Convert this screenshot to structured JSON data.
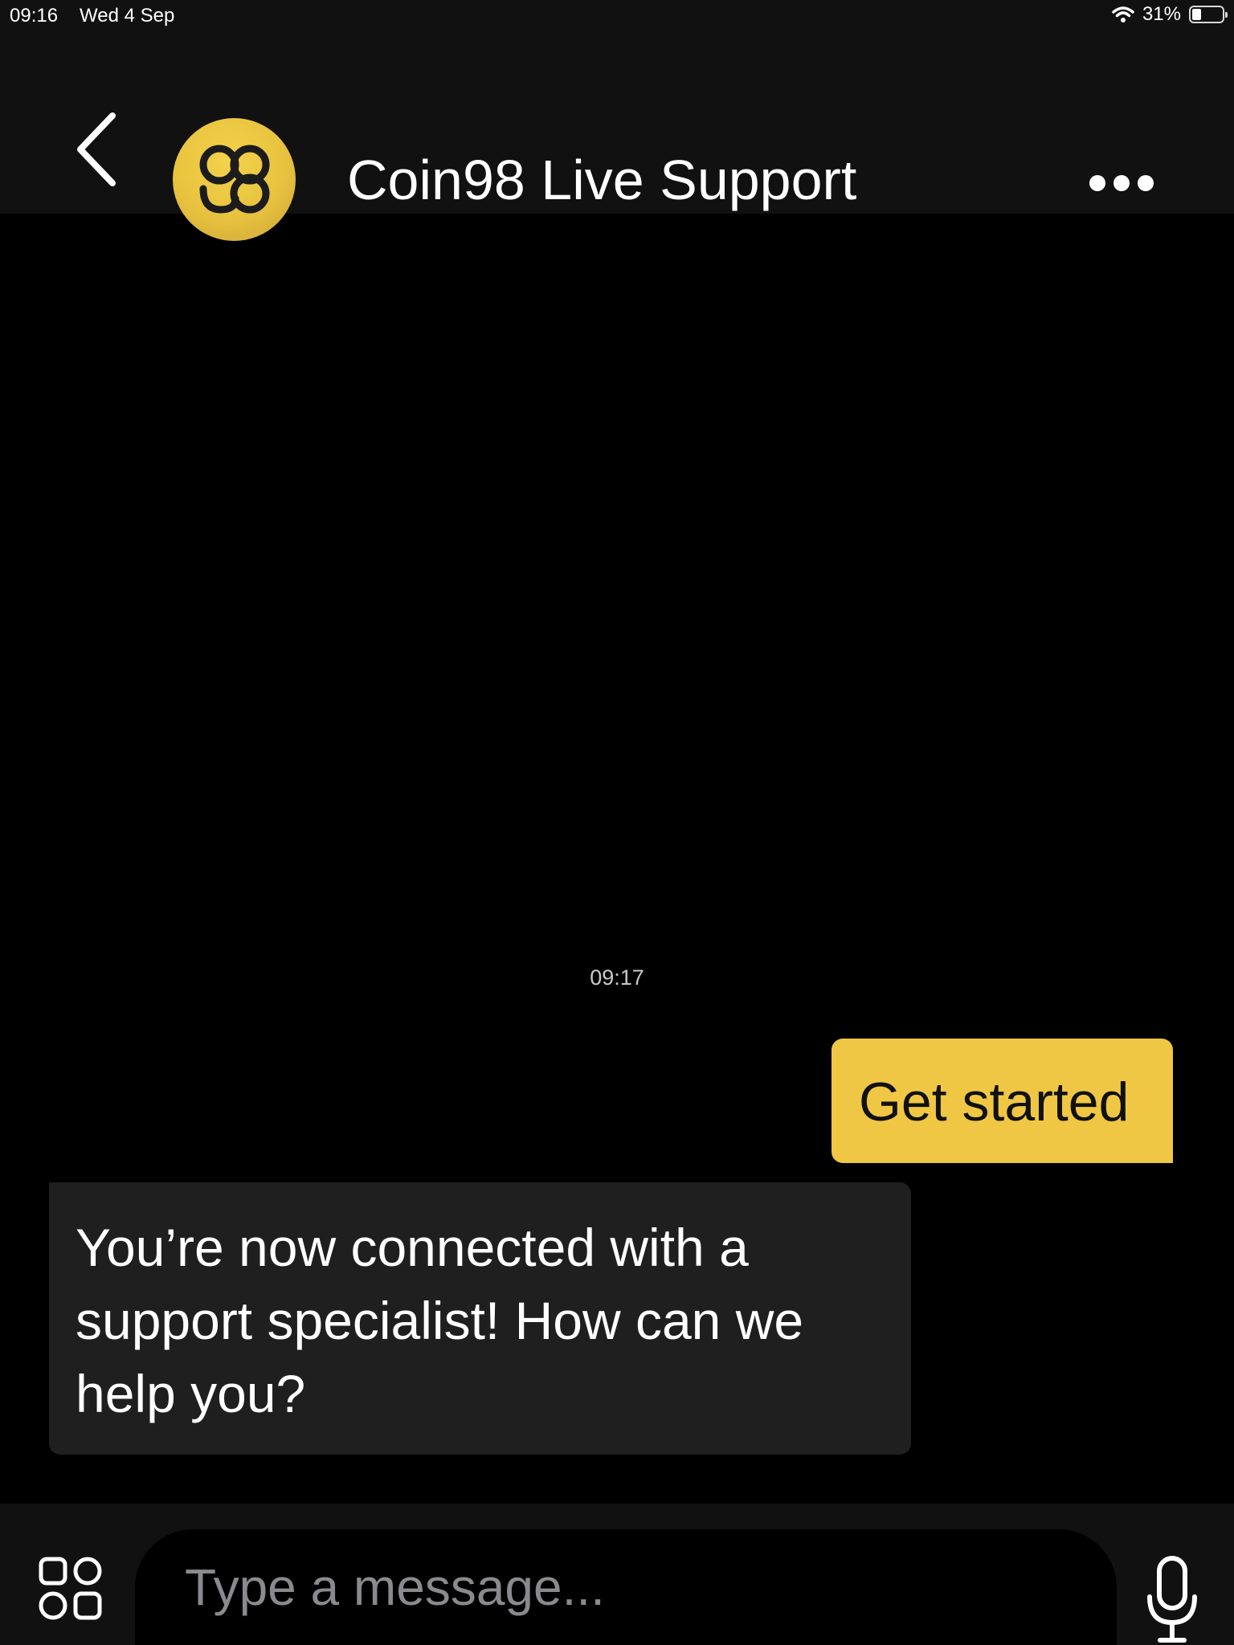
{
  "status_bar": {
    "time": "09:16",
    "date": "Wed 4 Sep",
    "battery": "31%",
    "battery_level": 0.31
  },
  "header": {
    "title": "Coin98 Live Support",
    "back_icon": "chevron-left-icon",
    "avatar_icon": "coin98-logo",
    "more_icon": "more-horizontal-icon"
  },
  "chat": {
    "timestamp": "09:17",
    "messages": [
      {
        "direction": "sent",
        "text": "Get started"
      },
      {
        "direction": "received",
        "text": "You’re now connected with a support specialist! How can we help you?"
      }
    ]
  },
  "composer": {
    "placeholder": "Type a message...",
    "value": "",
    "apps_icon": "apps-grid-icon",
    "mic_icon": "microphone-icon"
  },
  "colors": {
    "background": "#000000",
    "bar": "#111111",
    "accent": "#f0c744",
    "received_bubble": "#1f1f1f",
    "placeholder": "#8a8a8e"
  }
}
